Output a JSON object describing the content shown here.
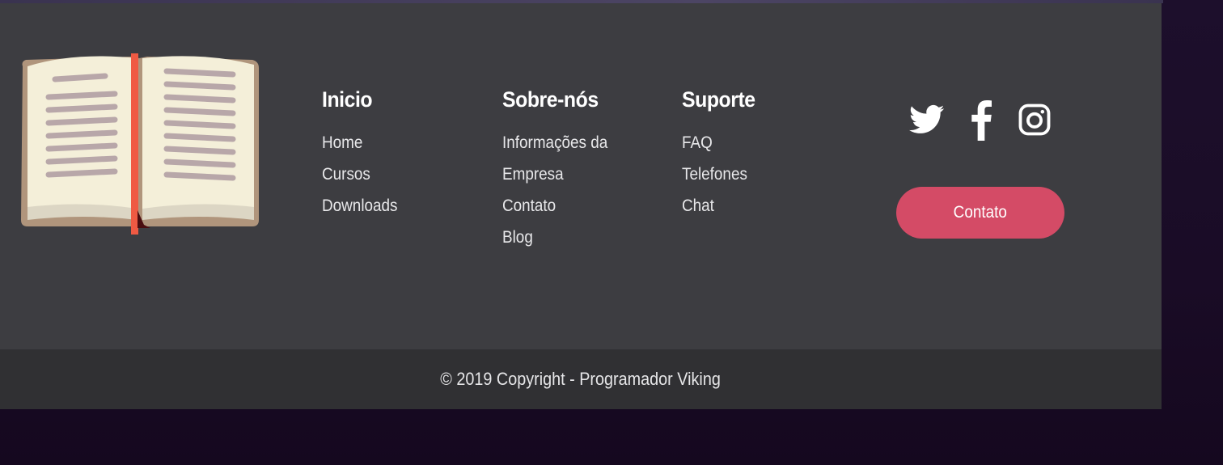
{
  "footer": {
    "columns": [
      {
        "title": "Inicio",
        "links": [
          "Home",
          "Cursos",
          "Downloads"
        ]
      },
      {
        "title": "Sobre-nós",
        "links": [
          "Informações da",
          "Empresa",
          "Contato",
          "Blog"
        ]
      },
      {
        "title": "Suporte",
        "links": [
          "FAQ",
          "Telefones",
          "Chat"
        ]
      }
    ],
    "social_icons": [
      "twitter-icon",
      "facebook-icon",
      "instagram-icon"
    ],
    "contact_button": "Contato",
    "copyright": "© 2019 Copyright - Programador Viking"
  },
  "colors": {
    "footer_bg": "#3d3d41",
    "copyright_bg": "#303033",
    "accent": "#d44b66",
    "page_bg": "#1d0f2c"
  }
}
